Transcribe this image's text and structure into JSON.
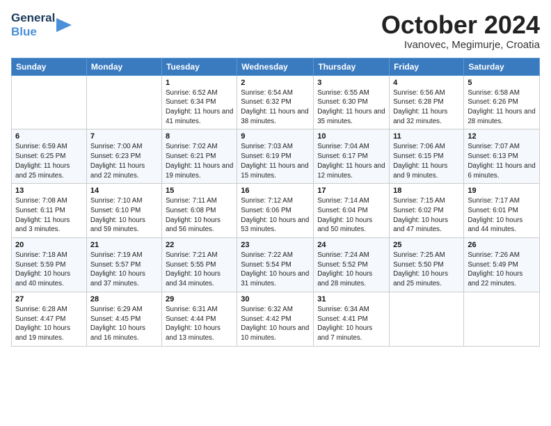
{
  "header": {
    "logo_line1": "General",
    "logo_line2": "Blue",
    "month": "October 2024",
    "location": "Ivanovec, Megimurje, Croatia"
  },
  "days_of_week": [
    "Sunday",
    "Monday",
    "Tuesday",
    "Wednesday",
    "Thursday",
    "Friday",
    "Saturday"
  ],
  "weeks": [
    [
      {
        "day": "",
        "info": ""
      },
      {
        "day": "",
        "info": ""
      },
      {
        "day": "1",
        "info": "Sunrise: 6:52 AM\nSunset: 6:34 PM\nDaylight: 11 hours and 41 minutes."
      },
      {
        "day": "2",
        "info": "Sunrise: 6:54 AM\nSunset: 6:32 PM\nDaylight: 11 hours and 38 minutes."
      },
      {
        "day": "3",
        "info": "Sunrise: 6:55 AM\nSunset: 6:30 PM\nDaylight: 11 hours and 35 minutes."
      },
      {
        "day": "4",
        "info": "Sunrise: 6:56 AM\nSunset: 6:28 PM\nDaylight: 11 hours and 32 minutes."
      },
      {
        "day": "5",
        "info": "Sunrise: 6:58 AM\nSunset: 6:26 PM\nDaylight: 11 hours and 28 minutes."
      }
    ],
    [
      {
        "day": "6",
        "info": "Sunrise: 6:59 AM\nSunset: 6:25 PM\nDaylight: 11 hours and 25 minutes."
      },
      {
        "day": "7",
        "info": "Sunrise: 7:00 AM\nSunset: 6:23 PM\nDaylight: 11 hours and 22 minutes."
      },
      {
        "day": "8",
        "info": "Sunrise: 7:02 AM\nSunset: 6:21 PM\nDaylight: 11 hours and 19 minutes."
      },
      {
        "day": "9",
        "info": "Sunrise: 7:03 AM\nSunset: 6:19 PM\nDaylight: 11 hours and 15 minutes."
      },
      {
        "day": "10",
        "info": "Sunrise: 7:04 AM\nSunset: 6:17 PM\nDaylight: 11 hours and 12 minutes."
      },
      {
        "day": "11",
        "info": "Sunrise: 7:06 AM\nSunset: 6:15 PM\nDaylight: 11 hours and 9 minutes."
      },
      {
        "day": "12",
        "info": "Sunrise: 7:07 AM\nSunset: 6:13 PM\nDaylight: 11 hours and 6 minutes."
      }
    ],
    [
      {
        "day": "13",
        "info": "Sunrise: 7:08 AM\nSunset: 6:11 PM\nDaylight: 11 hours and 3 minutes."
      },
      {
        "day": "14",
        "info": "Sunrise: 7:10 AM\nSunset: 6:10 PM\nDaylight: 10 hours and 59 minutes."
      },
      {
        "day": "15",
        "info": "Sunrise: 7:11 AM\nSunset: 6:08 PM\nDaylight: 10 hours and 56 minutes."
      },
      {
        "day": "16",
        "info": "Sunrise: 7:12 AM\nSunset: 6:06 PM\nDaylight: 10 hours and 53 minutes."
      },
      {
        "day": "17",
        "info": "Sunrise: 7:14 AM\nSunset: 6:04 PM\nDaylight: 10 hours and 50 minutes."
      },
      {
        "day": "18",
        "info": "Sunrise: 7:15 AM\nSunset: 6:02 PM\nDaylight: 10 hours and 47 minutes."
      },
      {
        "day": "19",
        "info": "Sunrise: 7:17 AM\nSunset: 6:01 PM\nDaylight: 10 hours and 44 minutes."
      }
    ],
    [
      {
        "day": "20",
        "info": "Sunrise: 7:18 AM\nSunset: 5:59 PM\nDaylight: 10 hours and 40 minutes."
      },
      {
        "day": "21",
        "info": "Sunrise: 7:19 AM\nSunset: 5:57 PM\nDaylight: 10 hours and 37 minutes."
      },
      {
        "day": "22",
        "info": "Sunrise: 7:21 AM\nSunset: 5:55 PM\nDaylight: 10 hours and 34 minutes."
      },
      {
        "day": "23",
        "info": "Sunrise: 7:22 AM\nSunset: 5:54 PM\nDaylight: 10 hours and 31 minutes."
      },
      {
        "day": "24",
        "info": "Sunrise: 7:24 AM\nSunset: 5:52 PM\nDaylight: 10 hours and 28 minutes."
      },
      {
        "day": "25",
        "info": "Sunrise: 7:25 AM\nSunset: 5:50 PM\nDaylight: 10 hours and 25 minutes."
      },
      {
        "day": "26",
        "info": "Sunrise: 7:26 AM\nSunset: 5:49 PM\nDaylight: 10 hours and 22 minutes."
      }
    ],
    [
      {
        "day": "27",
        "info": "Sunrise: 6:28 AM\nSunset: 4:47 PM\nDaylight: 10 hours and 19 minutes."
      },
      {
        "day": "28",
        "info": "Sunrise: 6:29 AM\nSunset: 4:45 PM\nDaylight: 10 hours and 16 minutes."
      },
      {
        "day": "29",
        "info": "Sunrise: 6:31 AM\nSunset: 4:44 PM\nDaylight: 10 hours and 13 minutes."
      },
      {
        "day": "30",
        "info": "Sunrise: 6:32 AM\nSunset: 4:42 PM\nDaylight: 10 hours and 10 minutes."
      },
      {
        "day": "31",
        "info": "Sunrise: 6:34 AM\nSunset: 4:41 PM\nDaylight: 10 hours and 7 minutes."
      },
      {
        "day": "",
        "info": ""
      },
      {
        "day": "",
        "info": ""
      }
    ]
  ]
}
